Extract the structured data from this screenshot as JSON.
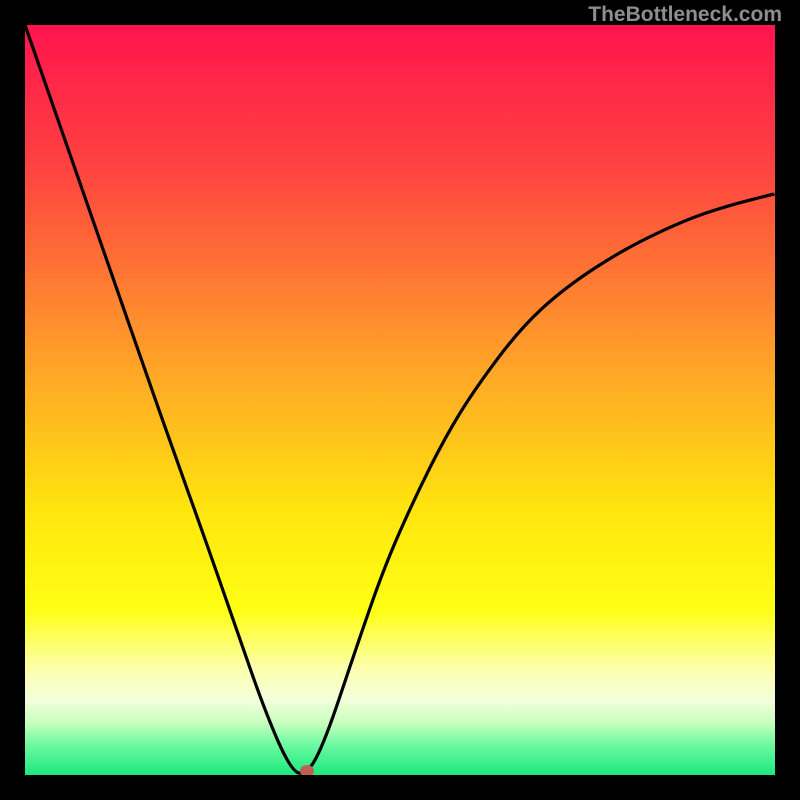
{
  "watermark": "TheBottleneck.com",
  "colors": {
    "border": "#000000",
    "curve": "#000000",
    "marker": "#c06055",
    "gradient_stops": [
      {
        "pct": 0,
        "color": "#ff144e"
      },
      {
        "pct": 20,
        "color": "#ff4640"
      },
      {
        "pct": 45,
        "color": "#ffa228"
      },
      {
        "pct": 65,
        "color": "#ffe60e"
      },
      {
        "pct": 78,
        "color": "#ffff14"
      },
      {
        "pct": 86,
        "color": "#fcffb0"
      },
      {
        "pct": 90,
        "color": "#f3ffda"
      },
      {
        "pct": 93,
        "color": "#c8ffbf"
      },
      {
        "pct": 96,
        "color": "#6cf9a0"
      },
      {
        "pct": 100,
        "color": "#1be87e"
      }
    ]
  },
  "chart_data": {
    "type": "line",
    "title": "",
    "xlabel": "",
    "ylabel": "",
    "x": [
      0.0,
      0.04,
      0.08,
      0.12,
      0.16,
      0.2,
      0.24,
      0.28,
      0.32,
      0.355,
      0.376,
      0.4,
      0.44,
      0.48,
      0.52,
      0.56,
      0.6,
      0.66,
      0.72,
      0.8,
      0.88,
      0.94,
      1.0
    ],
    "values": [
      1.0,
      0.885,
      0.77,
      0.655,
      0.54,
      0.426,
      0.315,
      0.2,
      0.085,
      0.005,
      0.0,
      0.045,
      0.165,
      0.28,
      0.37,
      0.45,
      0.515,
      0.595,
      0.65,
      0.702,
      0.74,
      0.76,
      0.775
    ],
    "xlim": [
      0,
      1
    ],
    "ylim": [
      0,
      1
    ],
    "minimum_point": {
      "x": 0.376,
      "y": 0.0
    },
    "grid": false
  }
}
